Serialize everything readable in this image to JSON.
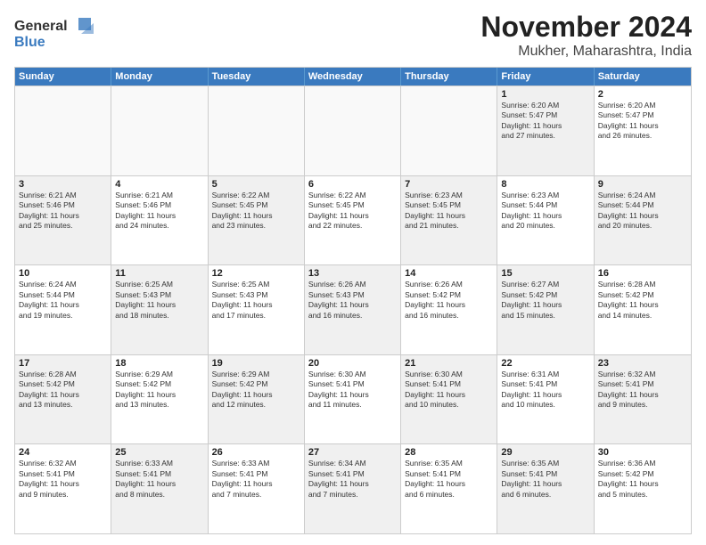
{
  "logo": {
    "line1": "General",
    "line2": "Blue"
  },
  "title": "November 2024",
  "location": "Mukher, Maharashtra, India",
  "headers": [
    "Sunday",
    "Monday",
    "Tuesday",
    "Wednesday",
    "Thursday",
    "Friday",
    "Saturday"
  ],
  "rows": [
    [
      {
        "day": "",
        "info": "",
        "empty": true
      },
      {
        "day": "",
        "info": "",
        "empty": true
      },
      {
        "day": "",
        "info": "",
        "empty": true
      },
      {
        "day": "",
        "info": "",
        "empty": true
      },
      {
        "day": "",
        "info": "",
        "empty": true
      },
      {
        "day": "1",
        "info": "Sunrise: 6:20 AM\nSunset: 5:47 PM\nDaylight: 11 hours\nand 27 minutes.",
        "shaded": true
      },
      {
        "day": "2",
        "info": "Sunrise: 6:20 AM\nSunset: 5:47 PM\nDaylight: 11 hours\nand 26 minutes.",
        "shaded": false
      }
    ],
    [
      {
        "day": "3",
        "info": "Sunrise: 6:21 AM\nSunset: 5:46 PM\nDaylight: 11 hours\nand 25 minutes.",
        "shaded": true
      },
      {
        "day": "4",
        "info": "Sunrise: 6:21 AM\nSunset: 5:46 PM\nDaylight: 11 hours\nand 24 minutes.",
        "shaded": false
      },
      {
        "day": "5",
        "info": "Sunrise: 6:22 AM\nSunset: 5:45 PM\nDaylight: 11 hours\nand 23 minutes.",
        "shaded": true
      },
      {
        "day": "6",
        "info": "Sunrise: 6:22 AM\nSunset: 5:45 PM\nDaylight: 11 hours\nand 22 minutes.",
        "shaded": false
      },
      {
        "day": "7",
        "info": "Sunrise: 6:23 AM\nSunset: 5:45 PM\nDaylight: 11 hours\nand 21 minutes.",
        "shaded": true
      },
      {
        "day": "8",
        "info": "Sunrise: 6:23 AM\nSunset: 5:44 PM\nDaylight: 11 hours\nand 20 minutes.",
        "shaded": false
      },
      {
        "day": "9",
        "info": "Sunrise: 6:24 AM\nSunset: 5:44 PM\nDaylight: 11 hours\nand 20 minutes.",
        "shaded": true
      }
    ],
    [
      {
        "day": "10",
        "info": "Sunrise: 6:24 AM\nSunset: 5:44 PM\nDaylight: 11 hours\nand 19 minutes.",
        "shaded": false
      },
      {
        "day": "11",
        "info": "Sunrise: 6:25 AM\nSunset: 5:43 PM\nDaylight: 11 hours\nand 18 minutes.",
        "shaded": true
      },
      {
        "day": "12",
        "info": "Sunrise: 6:25 AM\nSunset: 5:43 PM\nDaylight: 11 hours\nand 17 minutes.",
        "shaded": false
      },
      {
        "day": "13",
        "info": "Sunrise: 6:26 AM\nSunset: 5:43 PM\nDaylight: 11 hours\nand 16 minutes.",
        "shaded": true
      },
      {
        "day": "14",
        "info": "Sunrise: 6:26 AM\nSunset: 5:42 PM\nDaylight: 11 hours\nand 16 minutes.",
        "shaded": false
      },
      {
        "day": "15",
        "info": "Sunrise: 6:27 AM\nSunset: 5:42 PM\nDaylight: 11 hours\nand 15 minutes.",
        "shaded": true
      },
      {
        "day": "16",
        "info": "Sunrise: 6:28 AM\nSunset: 5:42 PM\nDaylight: 11 hours\nand 14 minutes.",
        "shaded": false
      }
    ],
    [
      {
        "day": "17",
        "info": "Sunrise: 6:28 AM\nSunset: 5:42 PM\nDaylight: 11 hours\nand 13 minutes.",
        "shaded": true
      },
      {
        "day": "18",
        "info": "Sunrise: 6:29 AM\nSunset: 5:42 PM\nDaylight: 11 hours\nand 13 minutes.",
        "shaded": false
      },
      {
        "day": "19",
        "info": "Sunrise: 6:29 AM\nSunset: 5:42 PM\nDaylight: 11 hours\nand 12 minutes.",
        "shaded": true
      },
      {
        "day": "20",
        "info": "Sunrise: 6:30 AM\nSunset: 5:41 PM\nDaylight: 11 hours\nand 11 minutes.",
        "shaded": false
      },
      {
        "day": "21",
        "info": "Sunrise: 6:30 AM\nSunset: 5:41 PM\nDaylight: 11 hours\nand 10 minutes.",
        "shaded": true
      },
      {
        "day": "22",
        "info": "Sunrise: 6:31 AM\nSunset: 5:41 PM\nDaylight: 11 hours\nand 10 minutes.",
        "shaded": false
      },
      {
        "day": "23",
        "info": "Sunrise: 6:32 AM\nSunset: 5:41 PM\nDaylight: 11 hours\nand 9 minutes.",
        "shaded": true
      }
    ],
    [
      {
        "day": "24",
        "info": "Sunrise: 6:32 AM\nSunset: 5:41 PM\nDaylight: 11 hours\nand 9 minutes.",
        "shaded": false
      },
      {
        "day": "25",
        "info": "Sunrise: 6:33 AM\nSunset: 5:41 PM\nDaylight: 11 hours\nand 8 minutes.",
        "shaded": true
      },
      {
        "day": "26",
        "info": "Sunrise: 6:33 AM\nSunset: 5:41 PM\nDaylight: 11 hours\nand 7 minutes.",
        "shaded": false
      },
      {
        "day": "27",
        "info": "Sunrise: 6:34 AM\nSunset: 5:41 PM\nDaylight: 11 hours\nand 7 minutes.",
        "shaded": true
      },
      {
        "day": "28",
        "info": "Sunrise: 6:35 AM\nSunset: 5:41 PM\nDaylight: 11 hours\nand 6 minutes.",
        "shaded": false
      },
      {
        "day": "29",
        "info": "Sunrise: 6:35 AM\nSunset: 5:41 PM\nDaylight: 11 hours\nand 6 minutes.",
        "shaded": true
      },
      {
        "day": "30",
        "info": "Sunrise: 6:36 AM\nSunset: 5:42 PM\nDaylight: 11 hours\nand 5 minutes.",
        "shaded": false
      }
    ]
  ]
}
